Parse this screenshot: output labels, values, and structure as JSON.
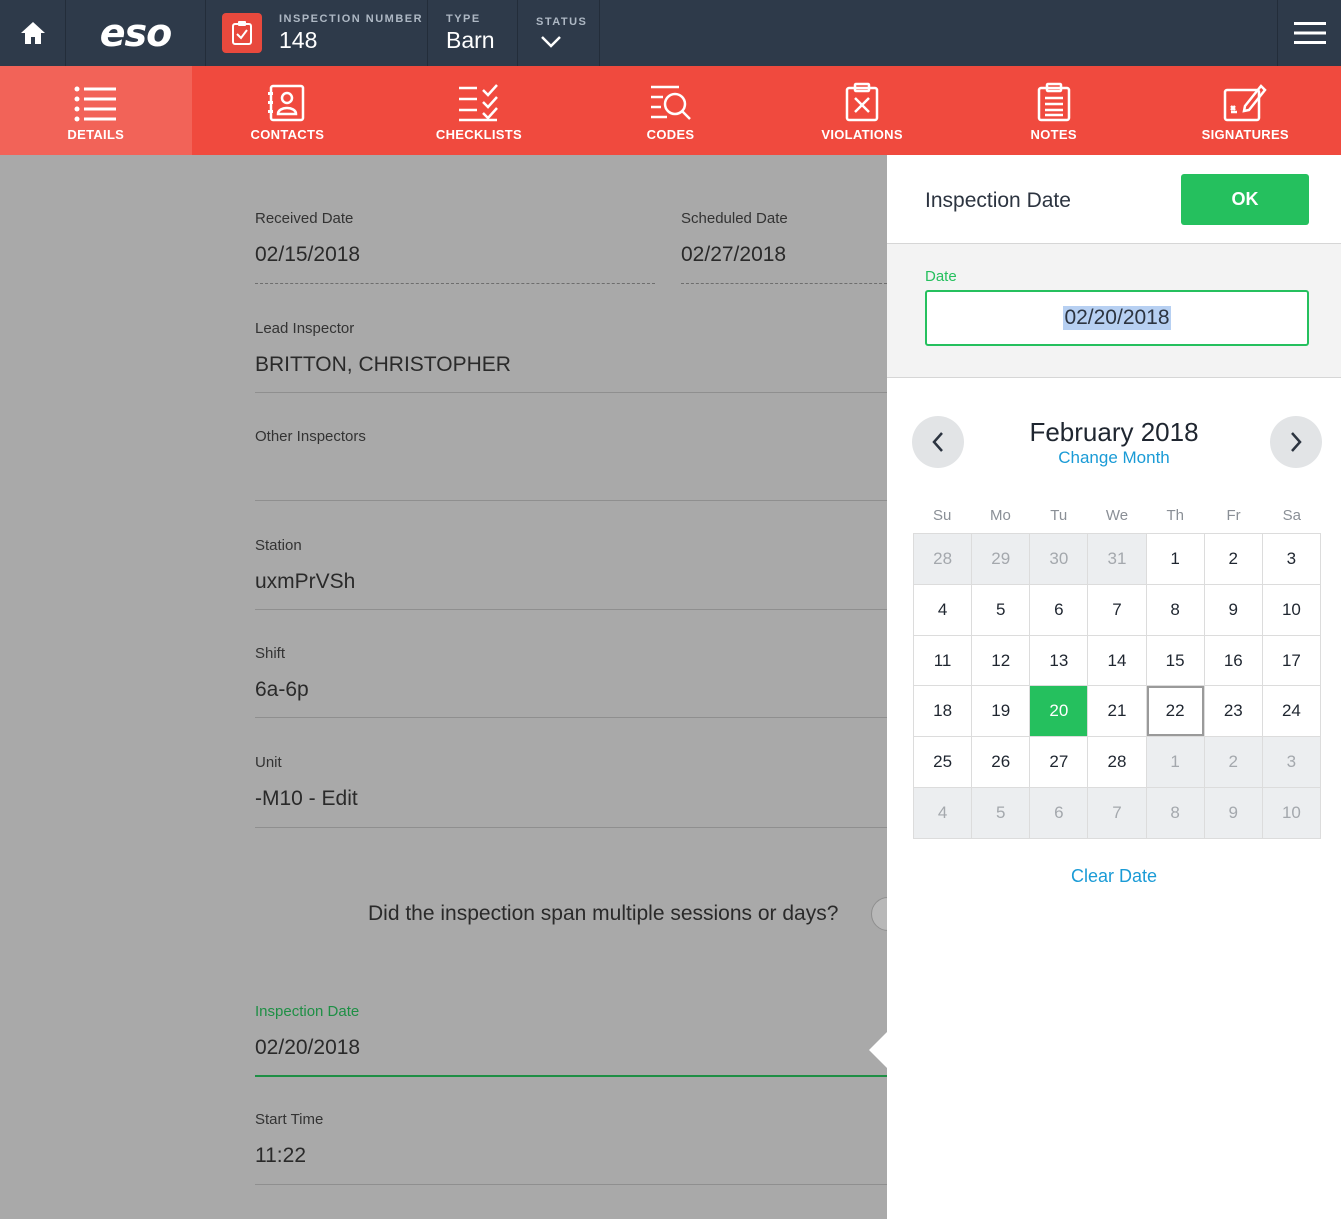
{
  "header": {
    "logo": "eso",
    "inspection_number_label": "INSPECTION NUMBER",
    "inspection_number": "148",
    "type_label": "TYPE",
    "type_value": "Barn",
    "status_label": "STATUS"
  },
  "nav": [
    {
      "label": "DETAILS",
      "icon": "list-icon"
    },
    {
      "label": "CONTACTS",
      "icon": "contact-book-icon"
    },
    {
      "label": "CHECKLISTS",
      "icon": "checklist-icon"
    },
    {
      "label": "CODES",
      "icon": "search-list-icon"
    },
    {
      "label": "VIOLATIONS",
      "icon": "clipboard-x-icon"
    },
    {
      "label": "NOTES",
      "icon": "clipboard-notes-icon"
    },
    {
      "label": "SIGNATURES",
      "icon": "signature-icon"
    }
  ],
  "form": {
    "received_label": "Received Date",
    "received_value": "02/15/2018",
    "scheduled_label": "Scheduled Date",
    "scheduled_value": "02/27/2018",
    "lead_label": "Lead Inspector",
    "lead_value": "BRITTON, CHRISTOPHER",
    "other_label": "Other Inspectors",
    "other_value": "",
    "station_label": "Station",
    "station_value": "uxmPrVSh",
    "shift_label": "Shift",
    "shift_value": "6a-6p",
    "unit_label": "Unit",
    "unit_value": "-M10 - Edit",
    "multi_question": "Did the inspection span multiple sessions or days?",
    "inspection_date_label": "Inspection Date",
    "inspection_date_value": "02/20/2018",
    "start_label": "Start Time",
    "start_value": "11:22"
  },
  "panel": {
    "title": "Inspection Date",
    "ok_label": "OK",
    "date_label": "Date",
    "date_value": "02/20/2018",
    "month_title": "February 2018",
    "change_month": "Change Month",
    "weekdays": [
      "Su",
      "Mo",
      "Tu",
      "We",
      "Th",
      "Fr",
      "Sa"
    ],
    "days": [
      [
        "28",
        "out"
      ],
      [
        "29",
        "out"
      ],
      [
        "30",
        "out"
      ],
      [
        "31",
        "out"
      ],
      [
        "1",
        ""
      ],
      [
        "2",
        ""
      ],
      [
        "3",
        ""
      ],
      [
        "4",
        ""
      ],
      [
        "5",
        ""
      ],
      [
        "6",
        ""
      ],
      [
        "7",
        ""
      ],
      [
        "8",
        ""
      ],
      [
        "9",
        ""
      ],
      [
        "10",
        ""
      ],
      [
        "11",
        ""
      ],
      [
        "12",
        ""
      ],
      [
        "13",
        ""
      ],
      [
        "14",
        ""
      ],
      [
        "15",
        ""
      ],
      [
        "16",
        ""
      ],
      [
        "17",
        ""
      ],
      [
        "18",
        ""
      ],
      [
        "19",
        ""
      ],
      [
        "20",
        "sel"
      ],
      [
        "21",
        ""
      ],
      [
        "22",
        "today"
      ],
      [
        "23",
        ""
      ],
      [
        "24",
        ""
      ],
      [
        "25",
        ""
      ],
      [
        "26",
        ""
      ],
      [
        "27",
        ""
      ],
      [
        "28",
        ""
      ],
      [
        "1",
        "out"
      ],
      [
        "2",
        "out"
      ],
      [
        "3",
        "out"
      ],
      [
        "4",
        "out"
      ],
      [
        "5",
        "out"
      ],
      [
        "6",
        "out"
      ],
      [
        "7",
        "out"
      ],
      [
        "8",
        "out"
      ],
      [
        "9",
        "out"
      ],
      [
        "10",
        "out"
      ]
    ],
    "clear_date": "Clear Date"
  },
  "colors": {
    "topbar": "#2e3a4a",
    "nav_red": "#f04a3e",
    "accent_green": "#25c05e",
    "link_blue": "#1a9bd6"
  }
}
